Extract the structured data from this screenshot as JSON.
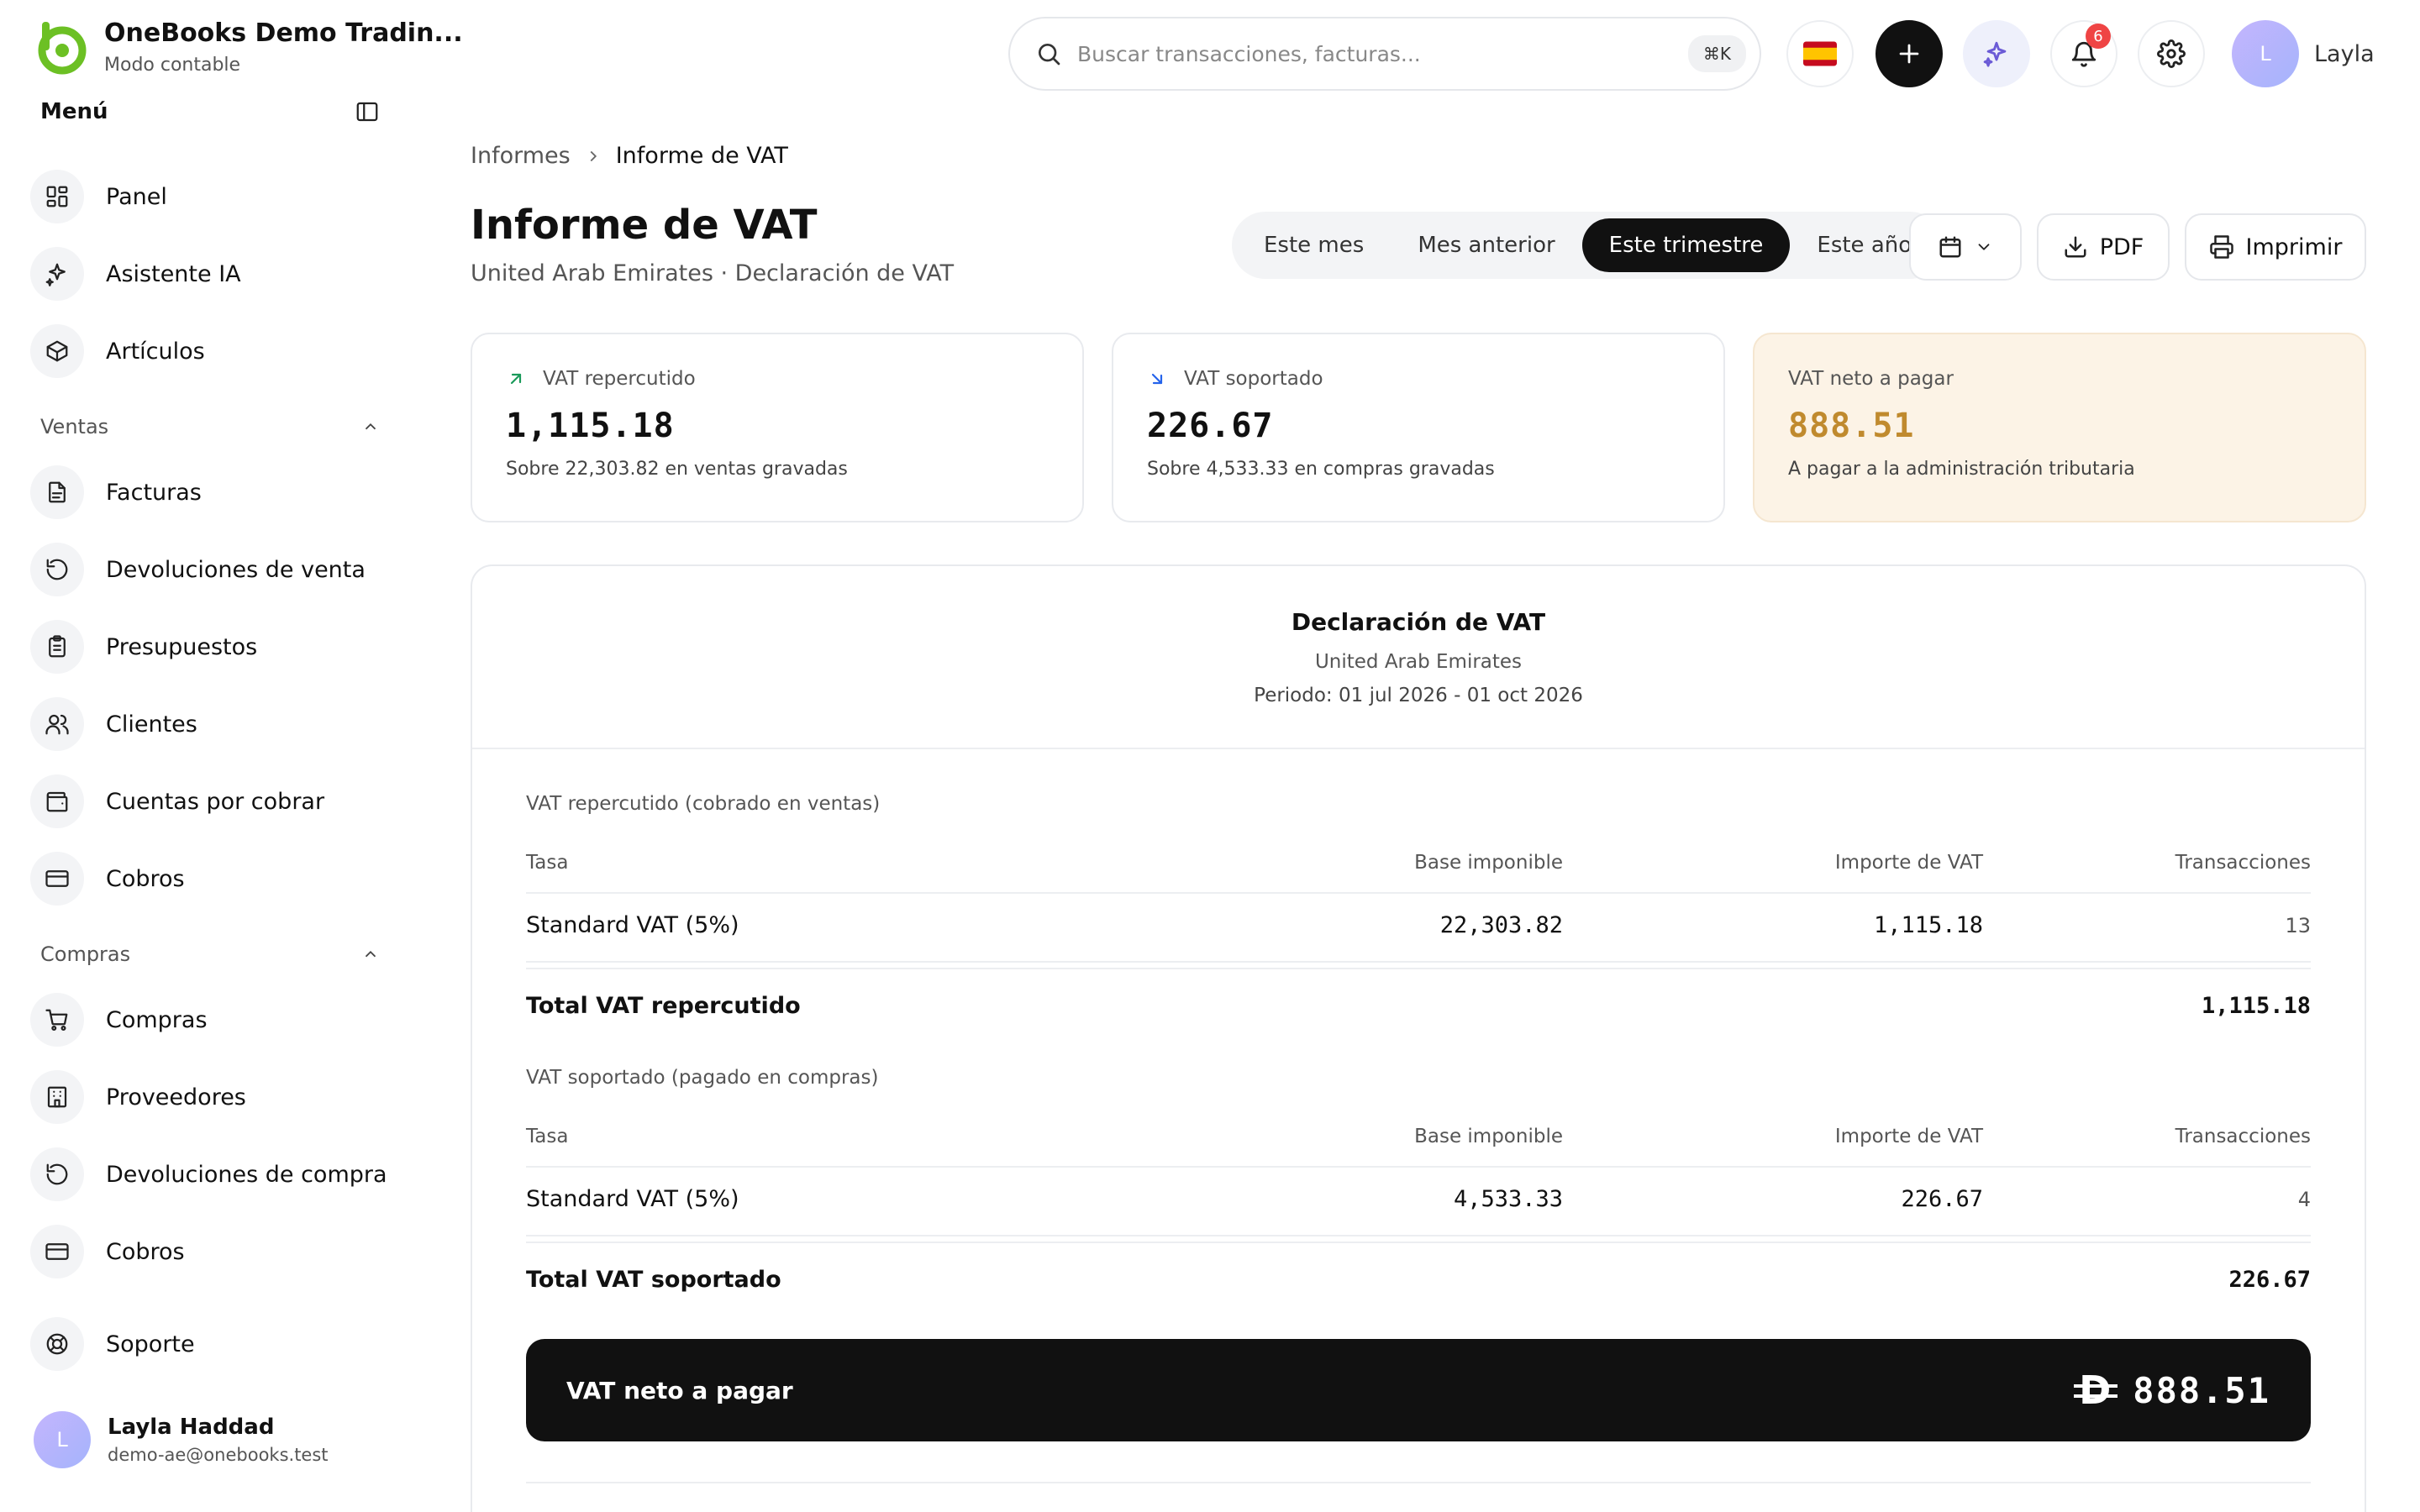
{
  "brand": {
    "name": "OneBooks Demo Tradin...",
    "mode": "Modo contable"
  },
  "menu": {
    "title": "Menú"
  },
  "nav": {
    "panel": "Panel",
    "assistant": "Asistente IA",
    "articles": "Artículos",
    "sales_group": "Ventas",
    "invoices": "Facturas",
    "sales_returns": "Devoluciones de venta",
    "quotes": "Presupuestos",
    "clients": "Clientes",
    "receivables": "Cuentas por cobrar",
    "collections": "Cobros",
    "purchases_group": "Compras",
    "purchases": "Compras",
    "suppliers": "Proveedores",
    "purchase_returns": "Devoluciones de compra",
    "payments": "Cobros",
    "support": "Soporte"
  },
  "user": {
    "initial": "L",
    "name": "Layla Haddad",
    "email": "demo-ae@onebooks.test",
    "first_name": "Layla"
  },
  "search": {
    "placeholder": "Buscar transacciones, facturas...",
    "shortcut": "⌘K"
  },
  "notifications": {
    "count": "6"
  },
  "breadcrumb": {
    "parent": "Informes",
    "current": "Informe de VAT"
  },
  "page": {
    "title": "Informe de VAT",
    "subtitle": "United Arab Emirates · Declaración de VAT"
  },
  "periods": {
    "this_month": "Este mes",
    "last_month": "Mes anterior",
    "this_quarter": "Este trimestre",
    "this_year": "Este año",
    "active": "Este trimestre"
  },
  "actions": {
    "pdf": "PDF",
    "print": "Imprimir"
  },
  "cards": {
    "output": {
      "label": "VAT repercutido",
      "value": "1,115.18",
      "note": "Sobre 22,303.82 en ventas gravadas"
    },
    "input": {
      "label": "VAT soportado",
      "value": "226.67",
      "note": "Sobre 4,533.33 en compras gravadas"
    },
    "net": {
      "label": "VAT neto a pagar",
      "value": "888.51",
      "note": "A pagar a la administración tributaria",
      "color": "#c08a2e"
    }
  },
  "report": {
    "title": "Declaración de VAT",
    "country": "United Arab Emirates",
    "period": "Periodo: 01 jul 2026 - 01 oct 2026",
    "columns": {
      "rate": "Tasa",
      "base": "Base imponible",
      "vat": "Importe de VAT",
      "transactions": "Transacciones"
    },
    "output_section": {
      "label": "VAT repercutido (cobrado en ventas)",
      "row": {
        "rate": "Standard VAT (5%)",
        "base": "22,303.82",
        "vat": "1,115.18",
        "transactions": "13"
      },
      "total_label": "Total VAT repercutido",
      "total_value": "1,115.18"
    },
    "input_section": {
      "label": "VAT soportado (pagado en compras)",
      "row": {
        "rate": "Standard VAT (5%)",
        "base": "4,533.33",
        "vat": "226.67",
        "transactions": "4"
      },
      "total_label": "Total VAT soportado",
      "total_value": "226.67"
    },
    "net": {
      "label": "VAT neto a pagar",
      "currency_symbol": "D",
      "value": "888.51"
    }
  },
  "colors": {
    "brand": "#6cc024",
    "dark": "#111111",
    "net_card_bg": "#fcf3e6"
  }
}
